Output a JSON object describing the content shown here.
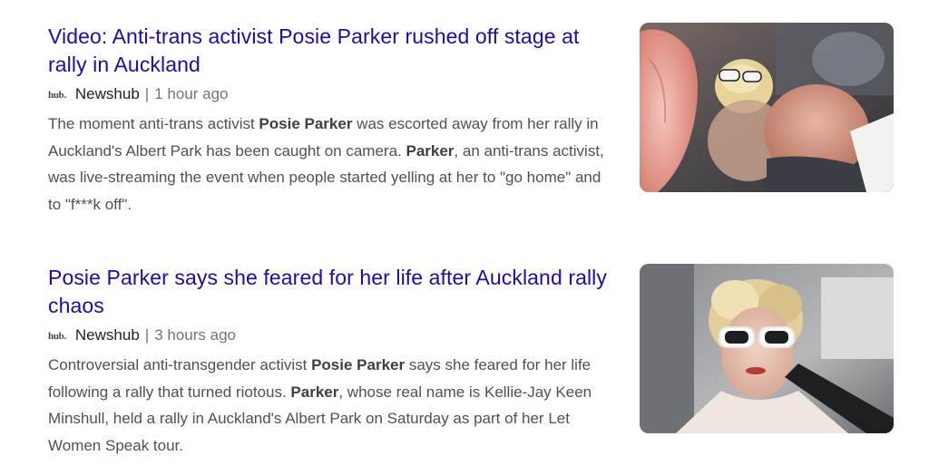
{
  "articles": [
    {
      "headline": "Video: Anti-trans activist Posie Parker rushed off stage at rally in Auckland",
      "source_logo": "hub.",
      "source": "Newshub",
      "separator": "|",
      "time": "1 hour ago",
      "snippet": [
        {
          "text": "The moment anti-trans activist ",
          "bold": false
        },
        {
          "text": "Posie Parker",
          "bold": true
        },
        {
          "text": " was escorted away from her rally in Auckland's Albert Park has been caught on camera. ",
          "bold": false
        },
        {
          "text": "Parker",
          "bold": true
        },
        {
          "text": ", an anti-trans activist, was live-streaming the event when people started yelling at her to \"go home\" and to \"f***k off\".",
          "bold": false
        }
      ],
      "thumbnail": "crowd-photo"
    },
    {
      "headline": "Posie Parker says she feared for her life after Auckland rally chaos",
      "source_logo": "hub.",
      "source": "Newshub",
      "separator": "|",
      "time": "3 hours ago",
      "snippet": [
        {
          "text": "Controversial anti-transgender activist ",
          "bold": false
        },
        {
          "text": "Posie Parker",
          "bold": true
        },
        {
          "text": " says she feared for her life following a rally that turned riotous. ",
          "bold": false
        },
        {
          "text": "Parker",
          "bold": true
        },
        {
          "text": ", whose real name is Kellie-Jay Keen Minshull, held a rally in Auckland's Albert Park on Saturday as part of her Let Women Speak tour.",
          "bold": false
        }
      ],
      "thumbnail": "car-selfie-photo"
    }
  ],
  "colors": {
    "headline": "#1a0dab",
    "snippet": "#4d5156",
    "meta": "#70757a"
  }
}
